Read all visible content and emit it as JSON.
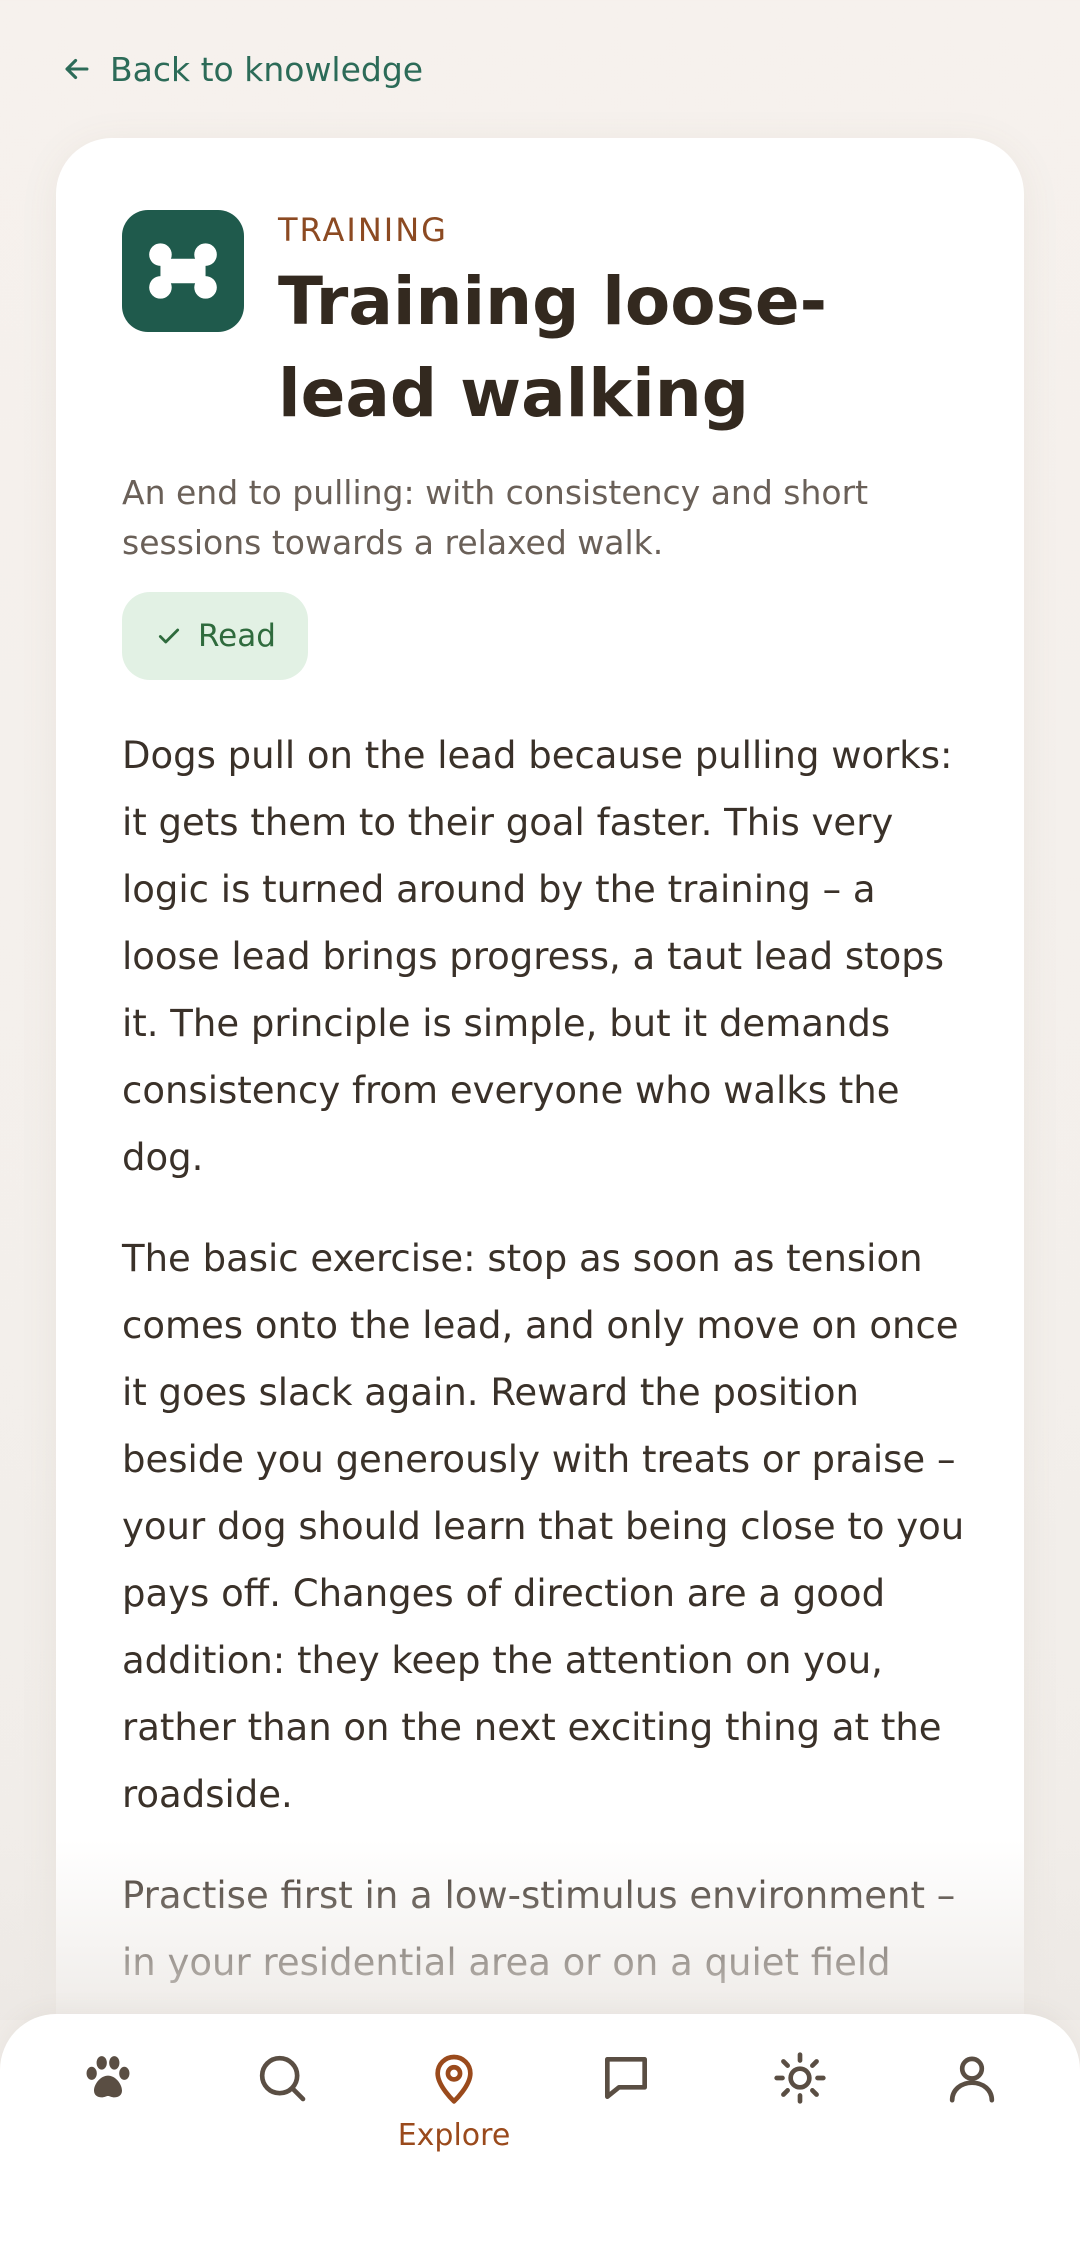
{
  "back_link": {
    "label": "Back to knowledge",
    "icon": "arrow-left-icon"
  },
  "article": {
    "icon": "bone-icon",
    "category": "TRAINING",
    "title": "Training loose-lead walking",
    "subtitle": "An end to pulling: with consistency and short sessions towards a relaxed walk.",
    "status_chip": {
      "label": "Read",
      "icon": "check-icon"
    },
    "paragraphs": [
      "Dogs pull on the lead because pulling works: it gets them to their goal faster. This very logic is turned around by the training – a loose lead brings progress, a taut lead stops it. The principle is simple, but it demands consistency from everyone who walks the dog.",
      "The basic exercise: stop as soon as tension comes onto the lead, and only move on once it goes slack again. Reward the position beside you generously with treats or praise – your dog should learn that being close to you pays off. Changes of direction are a good addition: they keep the attention on you, rather than on the next exciting thing at the roadside.",
      "Practise first in a low-stimulus environment – in your residential area or on a quiet field"
    ]
  },
  "bottom_nav": {
    "items": [
      {
        "id": "paw",
        "icon": "paw-icon",
        "label": ""
      },
      {
        "id": "search",
        "icon": "search-icon",
        "label": ""
      },
      {
        "id": "explore",
        "icon": "map-pin-icon",
        "label": "Explore",
        "active": true
      },
      {
        "id": "messages",
        "icon": "chat-bubble-icon",
        "label": ""
      },
      {
        "id": "weather",
        "icon": "sun-icon",
        "label": ""
      },
      {
        "id": "profile",
        "icon": "user-icon",
        "label": ""
      }
    ]
  },
  "colors": {
    "accent_green": "#1f5a4c",
    "link_green": "#2c6b58",
    "category_brown": "#8c4a22",
    "active_nav": "#9a4a1c",
    "chip_bg": "#e2f1e4",
    "chip_text": "#2f6b3d"
  }
}
